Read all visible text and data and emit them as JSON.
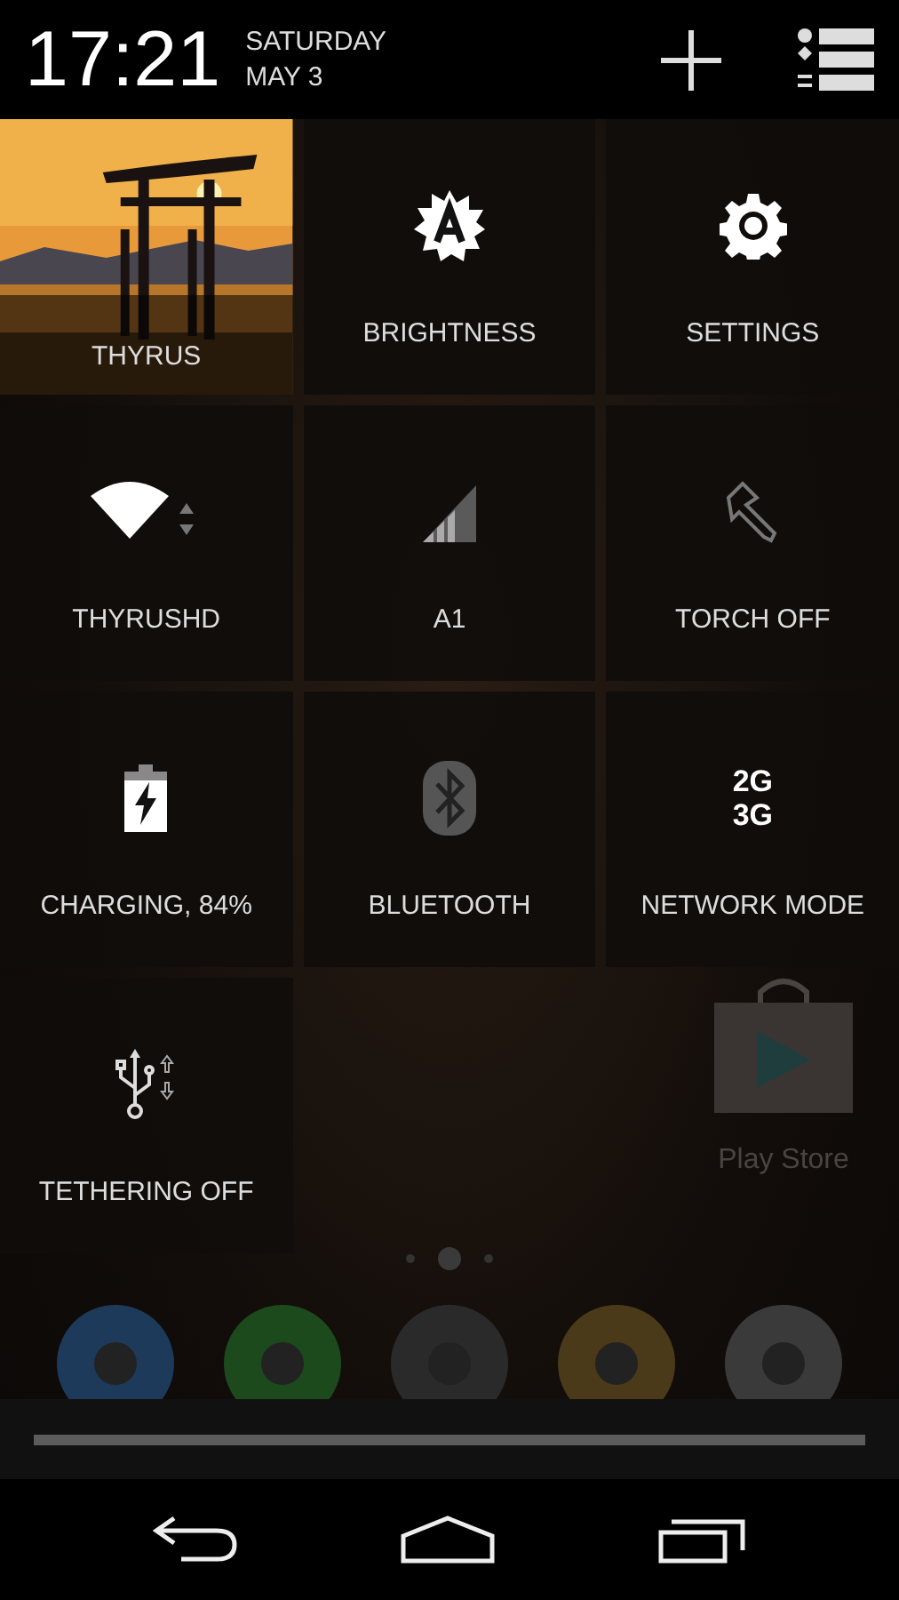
{
  "header": {
    "time": "17:21",
    "day": "SATURDAY",
    "date": "MAY 3"
  },
  "tiles": [
    {
      "kind": "user",
      "label": "THYRUS"
    },
    {
      "kind": "brightness",
      "label": "BRIGHTNESS"
    },
    {
      "kind": "settings",
      "label": "SETTINGS"
    },
    {
      "kind": "wifi",
      "label": "THYRUSHD"
    },
    {
      "kind": "signal",
      "label": "A1"
    },
    {
      "kind": "torch",
      "label": "TORCH OFF"
    },
    {
      "kind": "battery",
      "label": "CHARGING, 84%"
    },
    {
      "kind": "bluetooth",
      "label": "BLUETOOTH"
    },
    {
      "kind": "network",
      "label": "NETWORK MODE",
      "lines": [
        "2G",
        "3G"
      ]
    },
    {
      "kind": "tethering",
      "label": "TETHERING OFF"
    }
  ],
  "home": {
    "app_label": "Play Store"
  }
}
